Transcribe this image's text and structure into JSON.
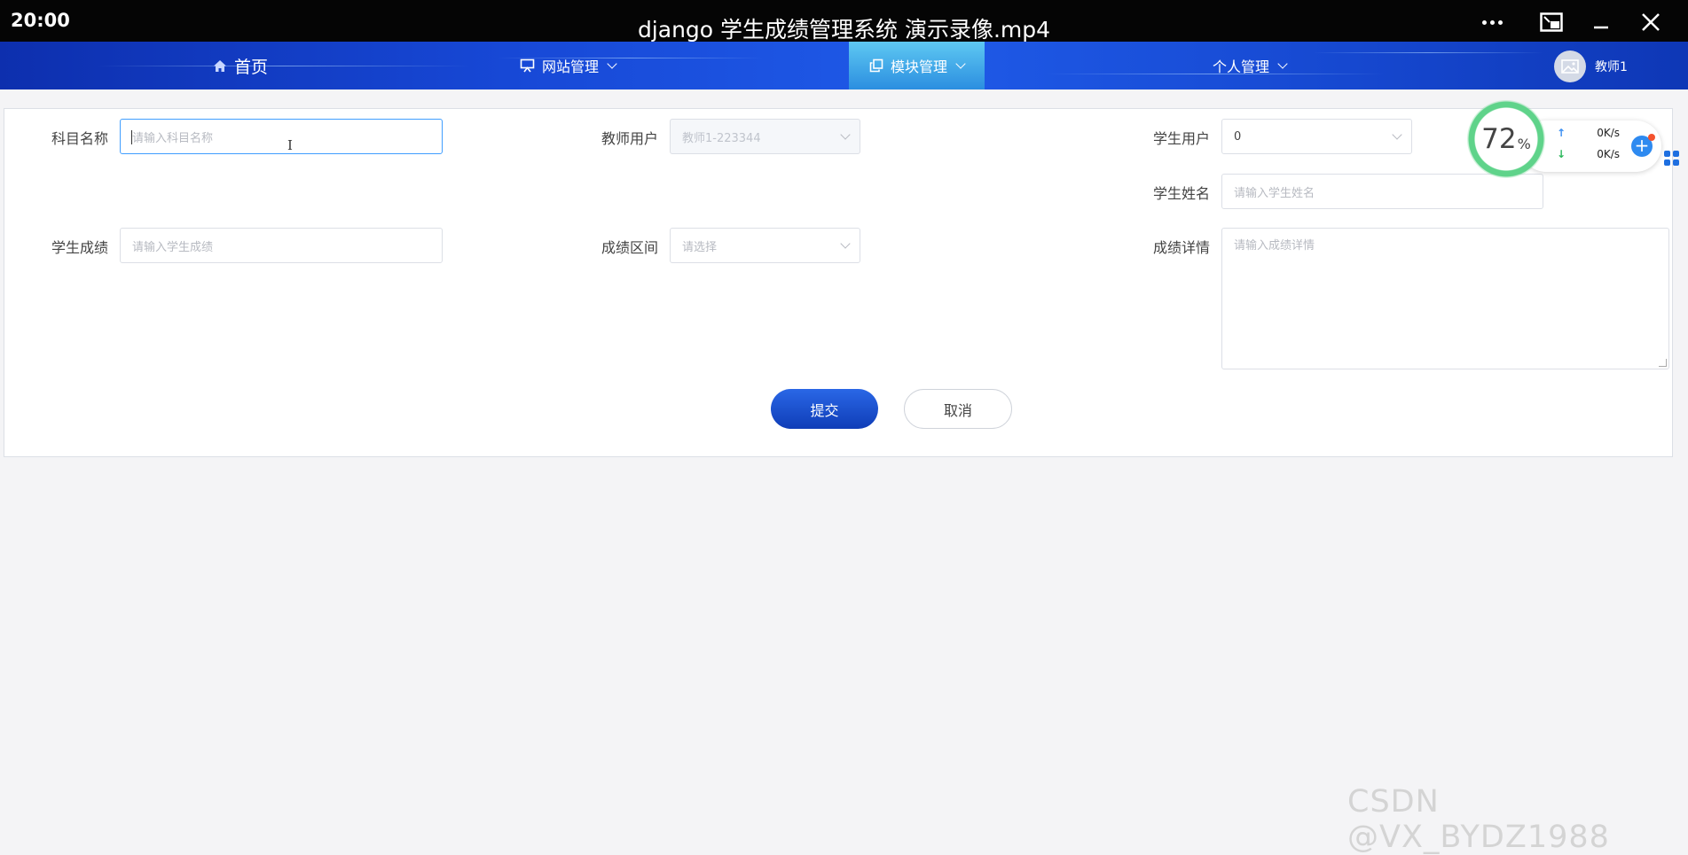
{
  "player": {
    "clock": "20:00",
    "title": "django 学生成绩管理系统 演示录像.mp4"
  },
  "nav": {
    "home": "首页",
    "site_manage": "网站管理",
    "module_manage": "模块管理",
    "personal_manage": "个人管理",
    "user_name": "教师1",
    "active": "module_manage"
  },
  "form": {
    "subject_label": "科目名称",
    "subject_placeholder": "请输入科目名称",
    "teacher_label": "教师用户",
    "teacher_value": "教师1-223344",
    "student_user_label": "学生用户",
    "student_user_value": "0",
    "student_name_label": "学生姓名",
    "student_name_placeholder": "请输入学生姓名",
    "score_label": "学生成绩",
    "score_placeholder": "请输入学生成绩",
    "range_label": "成绩区间",
    "range_placeholder": "请选择",
    "detail_label": "成绩详情",
    "detail_placeholder": "请输入成绩详情",
    "submit": "提交",
    "cancel": "取消"
  },
  "speed_monitor": {
    "cpu_value": "72",
    "cpu_unit": "%",
    "upload": "0K/s",
    "download": "0K/s"
  },
  "watermark": "CSDN @VX_BYDZ1988",
  "colors": {
    "nav_primary": "#1748d6",
    "nav_active": "#3fa9ea",
    "submit": "#1a4fcc",
    "focus_border": "#409eff",
    "cpu_ring": "#5fd38a"
  }
}
